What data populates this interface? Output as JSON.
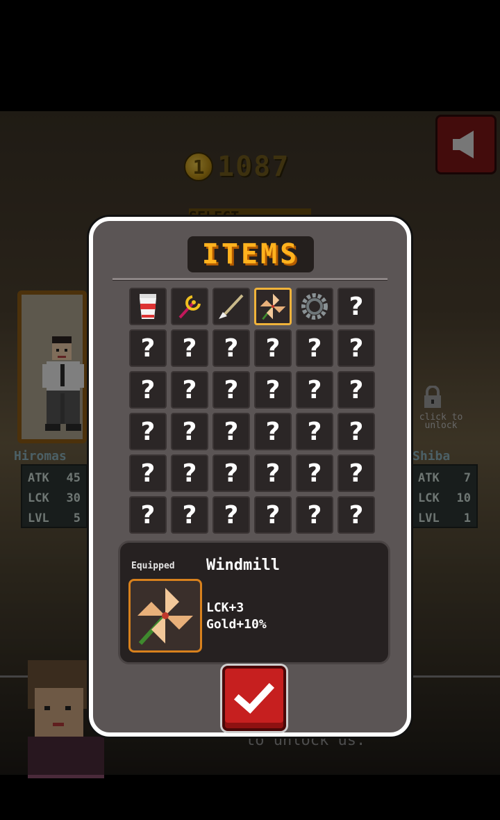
{
  "hud": {
    "coin_icon_glyph": "1",
    "coins": "1087",
    "select_banner": "SELECT"
  },
  "characters": {
    "left": {
      "name": "Hiromas",
      "stats": [
        {
          "label": "ATK",
          "value": "45"
        },
        {
          "label": "LCK",
          "value": "30"
        },
        {
          "label": "LVL",
          "value": "5"
        }
      ]
    },
    "right": {
      "name": "Shiba",
      "locked_text": "click to unlock",
      "stats": [
        {
          "label": "ATK",
          "value": "7"
        },
        {
          "label": "LCK",
          "value": "10"
        },
        {
          "label": "LVL",
          "value": "1"
        }
      ]
    }
  },
  "hint": "to unlock us.",
  "dialog": {
    "title": "ITEMS",
    "unknown_glyph": "?",
    "slots": [
      {
        "name": "cup-noodle",
        "known": true,
        "selected": false
      },
      {
        "name": "magic-staff",
        "known": true,
        "selected": false
      },
      {
        "name": "broom",
        "known": true,
        "selected": false
      },
      {
        "name": "windmill",
        "known": true,
        "selected": true
      },
      {
        "name": "gear",
        "known": true,
        "selected": false
      },
      {
        "known": false
      }
    ],
    "total_slots": 36,
    "equipped": {
      "label": "Equipped",
      "item_name": "Windmill",
      "effects": [
        "LCK+3",
        "Gold+10%"
      ]
    },
    "confirm_icon": "checkmark-icon"
  },
  "colors": {
    "dialog_bg": "#5b5555",
    "title": "#ffb21e",
    "selected_border": "#f0b33a",
    "confirm": "#c61f1f"
  }
}
